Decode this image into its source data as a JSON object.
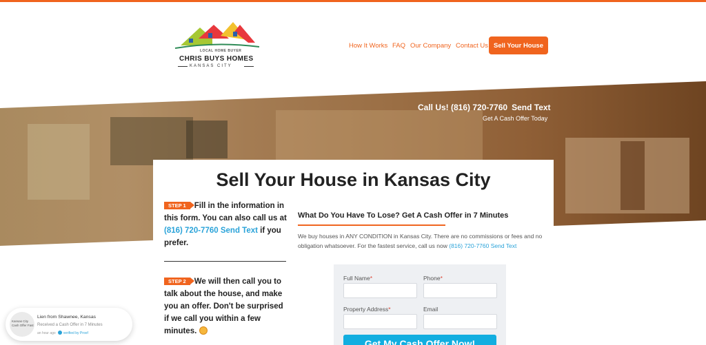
{
  "colors": {
    "accent": "#f0641e",
    "link": "#2aa3d9",
    "submit": "#12aee0"
  },
  "logo": {
    "small_text": "LOCAL HOME BUYER",
    "name": "CHRIS BUYS HOMES",
    "city": "KANSAS CITY"
  },
  "nav": {
    "items": [
      "How It Works",
      "FAQ",
      "Our Company",
      "Contact Us"
    ],
    "cta": "Sell Your House"
  },
  "hero": {
    "call_label": "Call Us! (816) 720-7760",
    "send_text": "Send Text",
    "subline": "Get A Cash Offer Today"
  },
  "card": {
    "title": "Sell Your House in Kansas City",
    "step1": {
      "badge": "STEP 1",
      "text_a": "Fill in the information in this form. You can also call us at",
      "phone": "(816) 720-7760",
      "send_text": "Send Text",
      "text_b": "if you prefer."
    },
    "step2": {
      "badge": "STEP 2",
      "text": "We will then call you to talk about the house, and make you an offer. Don't be surprised if we call you within a few minutes."
    },
    "heading": "What Do You Have To Lose? Get A Cash Offer in 7 Minutes",
    "paragraph": "We buy houses in ANY CONDITION in Kansas City. There are no commissions or fees and no obligation whatsoever. For the fastest service, call us now",
    "paragraph_phone": "(816) 720-7760",
    "paragraph_send_text": "Send Text"
  },
  "form": {
    "full_name_label": "Full Name",
    "phone_label": "Phone",
    "address_label": "Property Address",
    "email_label": "Email",
    "required_mark": "*",
    "submit": "Get My Cash Offer Now!"
  },
  "notification": {
    "avatar_text": "Kansas City Cash Offer Fast",
    "title": "Lien from Shawnee, Kansas",
    "subtitle": "Received a Cash Offer in 7 Minutes",
    "time": "an hour ago",
    "verified": "verified by Proof"
  }
}
